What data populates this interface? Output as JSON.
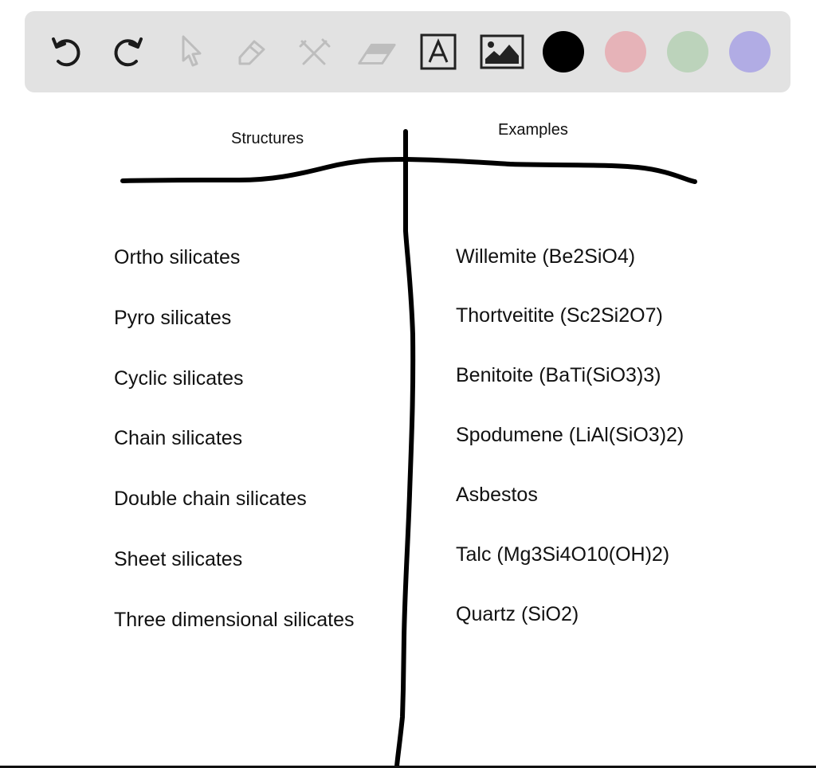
{
  "toolbar": {
    "tools": [
      {
        "name": "undo",
        "icon": "undo-icon",
        "enabled": true
      },
      {
        "name": "redo",
        "icon": "redo-icon",
        "enabled": true
      },
      {
        "name": "select",
        "icon": "cursor-icon",
        "enabled": false
      },
      {
        "name": "pen",
        "icon": "pencil-icon",
        "enabled": false
      },
      {
        "name": "tools",
        "icon": "wrench-hammer-icon",
        "enabled": false
      },
      {
        "name": "eraser",
        "icon": "eraser-icon",
        "enabled": false
      },
      {
        "name": "text",
        "icon": "text-box-icon",
        "enabled": true
      },
      {
        "name": "image",
        "icon": "image-icon",
        "enabled": true
      }
    ],
    "colors": [
      {
        "name": "black",
        "hex": "#000000"
      },
      {
        "name": "pink",
        "hex": "#e6b3b8"
      },
      {
        "name": "green",
        "hex": "#bcd3bb"
      },
      {
        "name": "purple",
        "hex": "#b1ace4"
      }
    ]
  },
  "canvas": {
    "headers": {
      "left": "Structures",
      "right": "Examples"
    },
    "structures": [
      "Ortho silicates",
      "Pyro silicates",
      "Cyclic silicates",
      "Chain silicates",
      "Double chain silicates",
      "Sheet silicates",
      "Three dimensional silicates"
    ],
    "examples": [
      "Willemite (Be2SiO4)",
      "Thortveitite (Sc2Si2O7)",
      "Benitoite (BaTi(SiO3)3)",
      "Spodumene (LiAl(SiO3)2)",
      "Asbestos",
      "Talc (Mg3Si4O10(OH)2)",
      "Quartz (SiO2)"
    ]
  }
}
